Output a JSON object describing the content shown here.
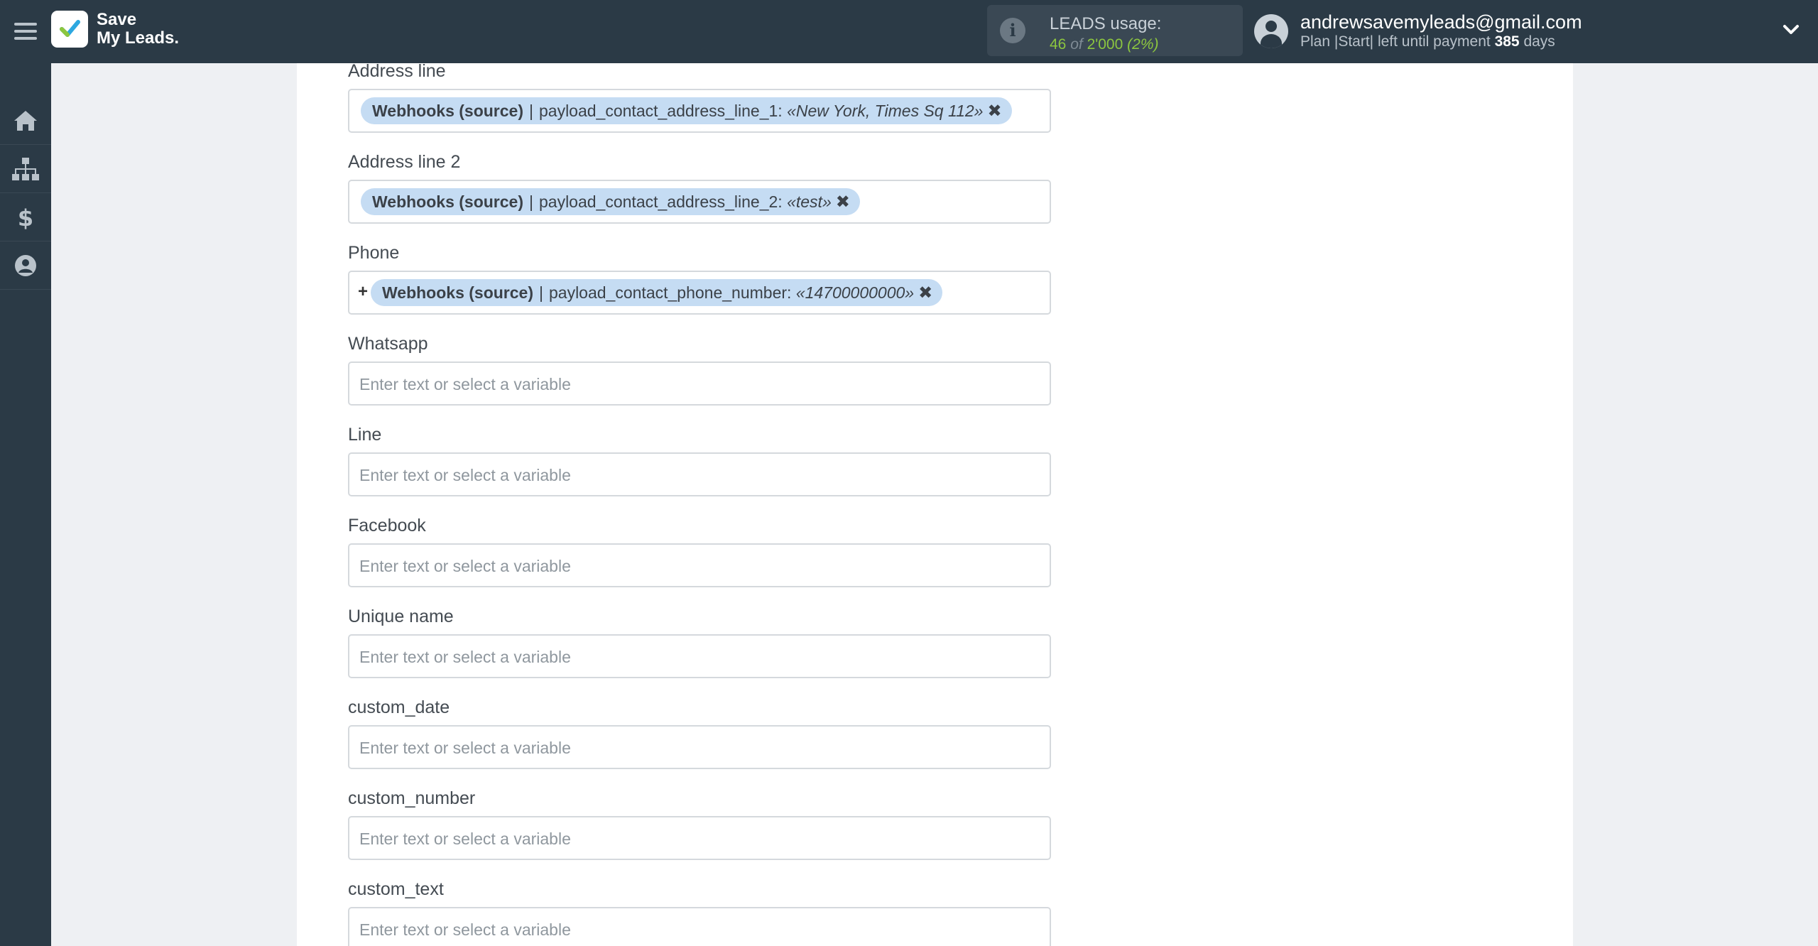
{
  "brand": {
    "line1": "Save",
    "line2": "My Leads."
  },
  "usage": {
    "title": "LEADS usage:",
    "used": "46",
    "of": "of",
    "total": "2'000",
    "percent": "(2%)"
  },
  "user": {
    "email": "andrewsavemyleads@gmail.com",
    "plan_prefix": "Plan |Start| left until payment",
    "days": "385",
    "days_suffix": "days"
  },
  "sidebar": {
    "items": [
      "home-icon",
      "sitemap-icon",
      "dollar-icon",
      "user-circle-icon"
    ]
  },
  "fields": {
    "address_line": {
      "label": "Address line",
      "tag": {
        "source": "Webhooks (source)",
        "sep": "|",
        "key": "payload_contact_address_line_1:",
        "value": "«New York, Times Sq 112»"
      }
    },
    "address_line_2": {
      "label": "Address line 2",
      "tag": {
        "source": "Webhooks (source)",
        "sep": "|",
        "key": "payload_contact_address_line_2:",
        "value": "«test»"
      }
    },
    "phone": {
      "label": "Phone",
      "prefix": "+",
      "tag": {
        "source": "Webhooks (source)",
        "sep": "|",
        "key": "payload_contact_phone_number:",
        "value": "«14700000000»"
      }
    },
    "whatsapp": {
      "label": "Whatsapp",
      "placeholder": "Enter text or select a variable"
    },
    "line": {
      "label": "Line",
      "placeholder": "Enter text or select a variable"
    },
    "facebook": {
      "label": "Facebook",
      "placeholder": "Enter text or select a variable"
    },
    "unique_name": {
      "label": "Unique name",
      "placeholder": "Enter text or select a variable"
    },
    "custom_date": {
      "label": "custom_date",
      "placeholder": "Enter text or select a variable"
    },
    "custom_number": {
      "label": "custom_number",
      "placeholder": "Enter text or select a variable"
    },
    "custom_text": {
      "label": "custom_text",
      "placeholder": "Enter text or select a variable"
    }
  },
  "tag_remove_symbol": "✖",
  "colors": {
    "topbar": "#2b3a46",
    "accent_green": "#8cc63f",
    "tag_bg": "#c5dcf3"
  }
}
